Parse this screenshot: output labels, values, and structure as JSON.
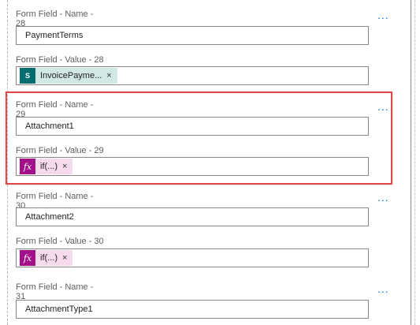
{
  "fields": [
    {
      "label": "Form Field - Name - 28",
      "type": "text",
      "value": "PaymentTerms",
      "more": "..."
    },
    {
      "label": "Form Field - Value - 28",
      "type": "chip",
      "chip_kind": "sharepoint",
      "chip_icon": "S",
      "value": "InvoicePayme...",
      "close": "×"
    },
    {
      "label": "Form Field - Name - 29",
      "type": "text",
      "value": "Attachment1",
      "more": "..."
    },
    {
      "label": "Form Field - Value - 29",
      "type": "chip",
      "chip_kind": "expression",
      "chip_icon": "fx",
      "value": "if(...)",
      "close": "×"
    },
    {
      "label": "Form Field - Name - 30",
      "type": "text",
      "value": "Attachment2",
      "more": "..."
    },
    {
      "label": "Form Field - Value - 30",
      "type": "chip",
      "chip_kind": "expression",
      "chip_icon": "fx",
      "value": "if(...)",
      "close": "×"
    },
    {
      "label": "Form Field - Name - 31",
      "type": "text",
      "value": "AttachmentType1",
      "more": "..."
    }
  ],
  "colors": {
    "highlight": "#e0474b",
    "accent": "#0078d4",
    "sharepoint": "#036c70",
    "expression": "#a4108a"
  }
}
